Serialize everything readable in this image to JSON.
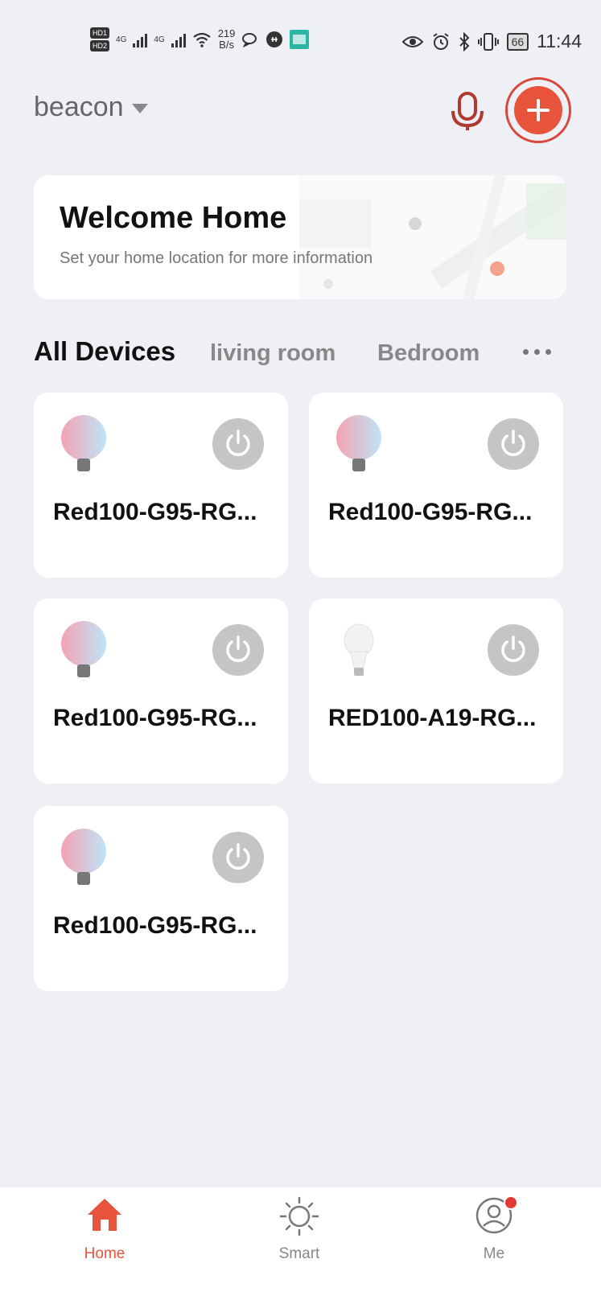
{
  "status_bar": {
    "hd1": "HD1",
    "hd2": "HD2",
    "net1": "4G",
    "net2": "4G",
    "speed_value": "219",
    "speed_unit": "B/s",
    "battery": "66",
    "time": "11:44"
  },
  "header": {
    "home_name": "beacon",
    "mic_icon": "microphone-icon",
    "add_icon": "plus-icon"
  },
  "welcome": {
    "title": "Welcome Home",
    "subtitle": "Set your home location for more information"
  },
  "tabs": {
    "all": "All Devices",
    "living": "living room",
    "bedroom": "Bedroom",
    "more_icon": "more-dots-icon"
  },
  "devices": [
    {
      "name": "Red100-G95-RG...",
      "icon": "globe-bulb-icon"
    },
    {
      "name": "Red100-G95-RG...",
      "icon": "globe-bulb-icon"
    },
    {
      "name": "Red100-G95-RG...",
      "icon": "globe-bulb-icon"
    },
    {
      "name": "RED100-A19-RG...",
      "icon": "a19-bulb-icon"
    },
    {
      "name": "Red100-G95-RG...",
      "icon": "globe-bulb-icon"
    }
  ],
  "nav": {
    "home": "Home",
    "smart": "Smart",
    "me": "Me"
  },
  "colors": {
    "accent": "#e8533b",
    "background": "#eef0f6",
    "power_button": "#c5c5c5"
  }
}
